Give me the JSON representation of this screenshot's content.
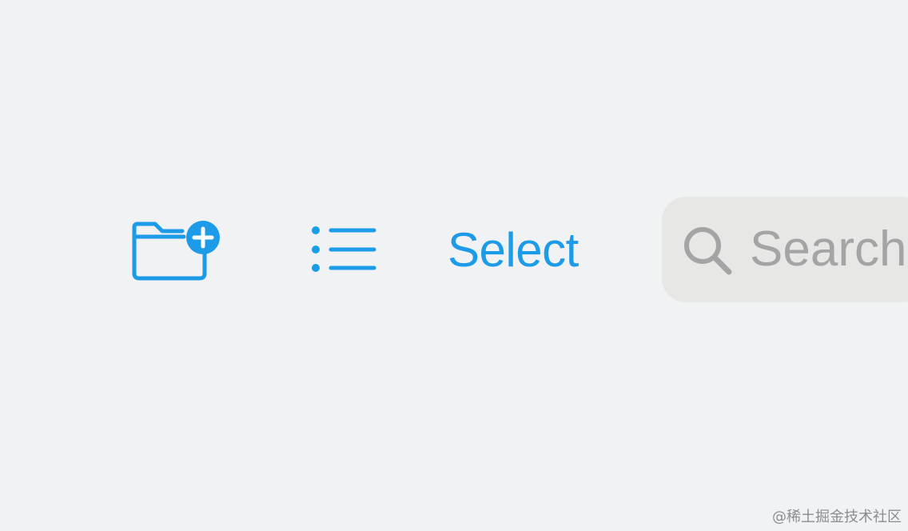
{
  "toolbar": {
    "new_folder": {
      "icon": "folder-plus-icon"
    },
    "list_view": {
      "icon": "list-bullet-icon"
    },
    "select_label": "Select",
    "search": {
      "icon": "magnifying-glass-icon",
      "placeholder": "Search"
    }
  },
  "watermark": "@稀土掘金技术社区",
  "colors": {
    "accent": "#1b9be8",
    "background": "#f1f2f4",
    "search_field": "#e7e8e6",
    "search_placeholder": "#a4a4a4"
  }
}
